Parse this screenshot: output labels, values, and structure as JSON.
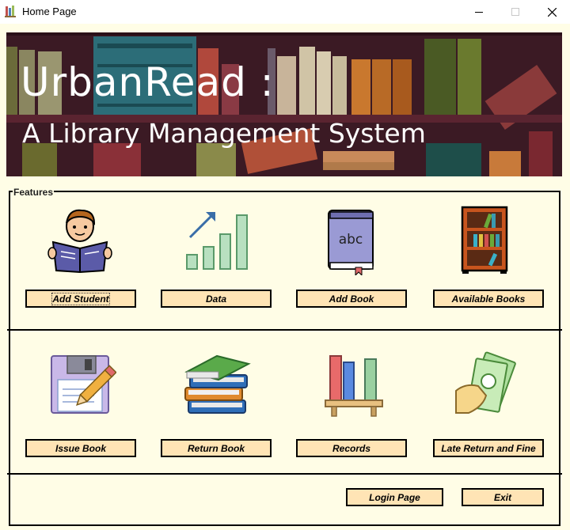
{
  "window": {
    "title": "Home Page"
  },
  "banner": {
    "title": "UrbanRead :",
    "subtitle": "A Library Management System"
  },
  "features": {
    "legend": "Features",
    "buttons": {
      "add_student": "Add Student",
      "data": "Data",
      "add_book": "Add Book",
      "available_books": "Available Books",
      "issue_book": "Issue Book",
      "return_book": "Return Book",
      "records": "Records",
      "late_return": "Late Return and Fine"
    },
    "book_cover_text": "abc"
  },
  "footer": {
    "login": "Login Page",
    "exit": "Exit"
  },
  "colors": {
    "background": "#fffde6",
    "button": "#ffe4b5",
    "banner": "#3b1a24"
  },
  "icons": [
    "reading-student-icon",
    "growth-chart-icon",
    "book-icon",
    "bookshelf-icon",
    "floppy-pencil-icon",
    "book-stack-icon",
    "shelf-books-icon",
    "money-hand-icon"
  ]
}
